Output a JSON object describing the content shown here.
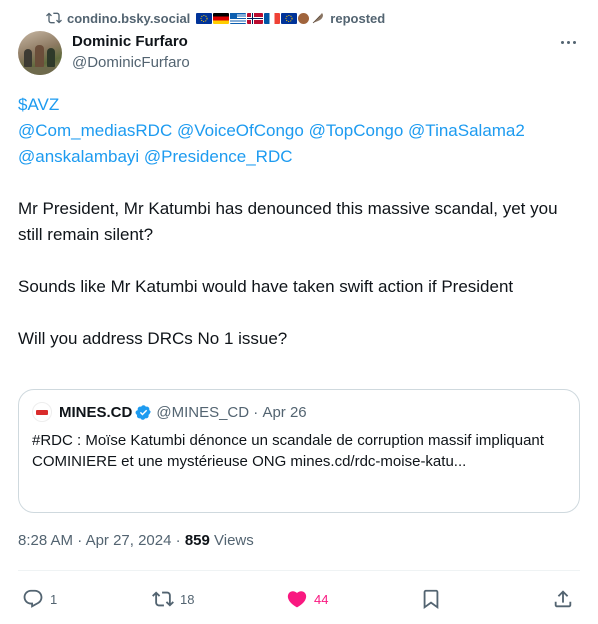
{
  "repost_banner": {
    "user": "condino.bsky.social",
    "suffix": "reposted",
    "flags": [
      {
        "name": "eu-flag",
        "color": "#003399"
      },
      {
        "name": "germany-flag",
        "color": "#000000"
      },
      {
        "name": "greece-flag",
        "color": "#0d5eaf"
      },
      {
        "name": "norway-flag",
        "color": "#ba0c2f"
      },
      {
        "name": "france-flag",
        "color": "#0055a4"
      },
      {
        "name": "eu-flag",
        "color": "#003399"
      }
    ]
  },
  "author": {
    "name": "Dominic Furfaro",
    "handle": "@DominicFurfaro"
  },
  "tweet": {
    "line1_cashtag": "$AVZ",
    "mentions_line2": "@Com_mediasRDC @VoiceOfCongo @TopCongo @TinaSalama2",
    "mentions_line3": "@anskalambayi @Presidence_RDC",
    "para1": "Mr President, Mr Katumbi has denounced this massive scandal, yet you still remain silent?",
    "para2": "Sounds like Mr Katumbi would have taken swift action if President",
    "para3": "Will you address DRCs No 1 issue?"
  },
  "quote": {
    "name": "MINES.CD",
    "handle": "@MINES_CD",
    "separator": " · ",
    "date": "Apr 26",
    "text": "#RDC : Moïse Katumbi dénonce un scandale de corruption massif impliquant COMINIERE et une mystérieuse ONG mines.cd/rdc-moise-katu..."
  },
  "meta": {
    "time": "8:28 AM",
    "separator": " · ",
    "date": "Apr 27, 2024",
    "separator2": " · ",
    "views_count": "859",
    "views_label": " Views"
  },
  "actions": {
    "replies": "1",
    "reposts": "18",
    "likes": "44",
    "liked": true,
    "like_color": "#f91880"
  },
  "icons": {
    "repost_banner_icon": "repost-icon",
    "more_icon": "more-icon",
    "verified_icon": "verified-badge-icon",
    "reply_icon": "reply-icon",
    "repost_icon": "repost-icon",
    "like_icon": "heart-icon",
    "bookmark_icon": "bookmark-icon",
    "share_icon": "share-icon"
  },
  "colors": {
    "link": "#1d9bf0",
    "secondary_text": "#536471",
    "verified": "#1d9bf0"
  }
}
